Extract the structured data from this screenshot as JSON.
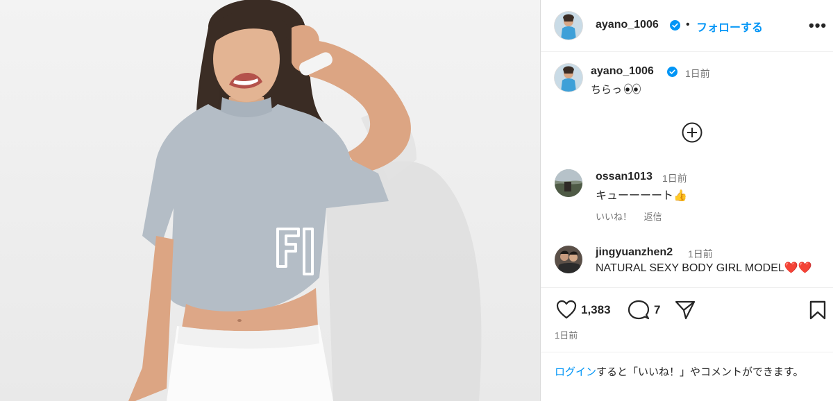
{
  "post": {
    "username": "ayano_1006",
    "dot": "•",
    "follow_label": "フォローする",
    "more_label": "•••",
    "caption_time": "1日前",
    "caption_text": "ちらっ",
    "caption_emoji": "eyes-emoji"
  },
  "comments": [
    {
      "username": "ossan1013",
      "time": "1日前",
      "text": "キューーーート👍",
      "like_label": "いいね！",
      "reply_label": "返信"
    },
    {
      "username": "jingyuanzhen2",
      "time": "1日前",
      "text": "NATURAL SEXY BODY GIRL MODEL❤️❤️"
    }
  ],
  "actions": {
    "like_count": "1,383",
    "comment_count": "7",
    "post_time": "1日前"
  },
  "login_prompt": {
    "link_text": "ログイン",
    "rest_text": "すると「いいね！」やコメントができます。"
  },
  "colors": {
    "link_blue": "#0095f6",
    "verified_blue": "#0095f6",
    "muted_text": "#737373",
    "shirt_grey": "#b4bdc6"
  },
  "icons": [
    "verified-badge-icon",
    "add-comment-plus-icon",
    "heart-icon",
    "comment-bubble-icon",
    "share-paper-plane-icon",
    "bookmark-icon"
  ]
}
